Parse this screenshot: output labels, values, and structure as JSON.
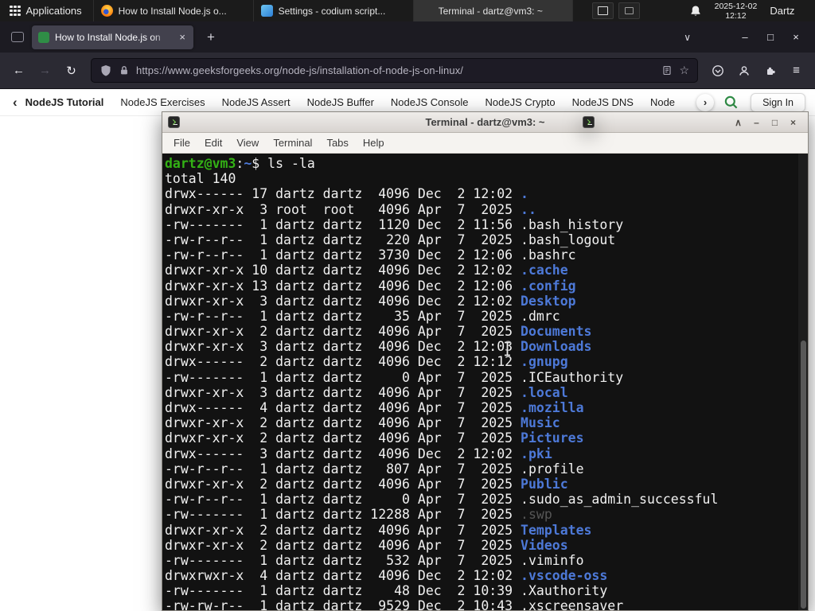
{
  "panel": {
    "applications_label": "Applications",
    "tasks": [
      {
        "label": "How to Install Node.js o...",
        "icon": "firefox",
        "active": false
      },
      {
        "label": "Settings - codium script...",
        "icon": "codium",
        "active": false
      },
      {
        "label": "Terminal - dartz@vm3: ~",
        "icon": "terminal",
        "active": true
      }
    ],
    "clock": {
      "date": "2025-12-02",
      "time": "12:12"
    },
    "user_label": "Dartz"
  },
  "browser": {
    "tab_title": "How to Install Node.js on",
    "url": "https://www.geeksforgeeks.org/node-js/installation-of-node-js-on-linux/"
  },
  "gfg_nav": {
    "items": [
      "NodeJS Tutorial",
      "NodeJS Exercises",
      "NodeJS Assert",
      "NodeJS Buffer",
      "NodeJS Console",
      "NodeJS Crypto",
      "NodeJS DNS",
      "Node"
    ],
    "sign_in_label": "Sign In"
  },
  "terminal": {
    "window_title": "Terminal - dartz@vm3: ~",
    "menu": [
      "File",
      "Edit",
      "View",
      "Terminal",
      "Tabs",
      "Help"
    ],
    "prompt": {
      "user": "dartz@vm3",
      "sep": ":",
      "path": "~",
      "symbol": "$ ",
      "command": "ls -la"
    },
    "total": "total 140",
    "listing": [
      {
        "meta": "drwx------ 17 dartz dartz  4096 Dec  2 12:02 ",
        "name": ".",
        "type": "dir"
      },
      {
        "meta": "drwxr-xr-x  3 root  root   4096 Apr  7  2025 ",
        "name": "..",
        "type": "dir"
      },
      {
        "meta": "-rw-------  1 dartz dartz  1120 Dec  2 11:56 ",
        "name": ".bash_history",
        "type": "file"
      },
      {
        "meta": "-rw-r--r--  1 dartz dartz   220 Apr  7  2025 ",
        "name": ".bash_logout",
        "type": "file"
      },
      {
        "meta": "-rw-r--r--  1 dartz dartz  3730 Dec  2 12:06 ",
        "name": ".bashrc",
        "type": "file"
      },
      {
        "meta": "drwxr-xr-x 10 dartz dartz  4096 Dec  2 12:02 ",
        "name": ".cache",
        "type": "dir"
      },
      {
        "meta": "drwxr-xr-x 13 dartz dartz  4096 Dec  2 12:06 ",
        "name": ".config",
        "type": "dir"
      },
      {
        "meta": "drwxr-xr-x  3 dartz dartz  4096 Dec  2 12:02 ",
        "name": "Desktop",
        "type": "dir"
      },
      {
        "meta": "-rw-r--r--  1 dartz dartz    35 Apr  7  2025 ",
        "name": ".dmrc",
        "type": "file"
      },
      {
        "meta": "drwxr-xr-x  2 dartz dartz  4096 Apr  7  2025 ",
        "name": "Documents",
        "type": "dir"
      },
      {
        "meta": "drwxr-xr-x  3 dartz dartz  4096 Dec  2 12:03 ",
        "name": "Downloads",
        "type": "dir"
      },
      {
        "meta": "drwx------  2 dartz dartz  4096 Dec  2 12:12 ",
        "name": ".gnupg",
        "type": "dir"
      },
      {
        "meta": "-rw-------  1 dartz dartz     0 Apr  7  2025 ",
        "name": ".ICEauthority",
        "type": "file"
      },
      {
        "meta": "drwxr-xr-x  3 dartz dartz  4096 Apr  7  2025 ",
        "name": ".local",
        "type": "dir"
      },
      {
        "meta": "drwx------  4 dartz dartz  4096 Apr  7  2025 ",
        "name": ".mozilla",
        "type": "dir"
      },
      {
        "meta": "drwxr-xr-x  2 dartz dartz  4096 Apr  7  2025 ",
        "name": "Music",
        "type": "dir"
      },
      {
        "meta": "drwxr-xr-x  2 dartz dartz  4096 Apr  7  2025 ",
        "name": "Pictures",
        "type": "dir"
      },
      {
        "meta": "drwx------  3 dartz dartz  4096 Dec  2 12:02 ",
        "name": ".pki",
        "type": "dir"
      },
      {
        "meta": "-rw-r--r--  1 dartz dartz   807 Apr  7  2025 ",
        "name": ".profile",
        "type": "file"
      },
      {
        "meta": "drwxr-xr-x  2 dartz dartz  4096 Apr  7  2025 ",
        "name": "Public",
        "type": "dir"
      },
      {
        "meta": "-rw-r--r--  1 dartz dartz     0 Apr  7  2025 ",
        "name": ".sudo_as_admin_successful",
        "type": "file"
      },
      {
        "meta": "-rw-------  1 dartz dartz 12288 Apr  7  2025 ",
        "name": ".swp",
        "type": "dim"
      },
      {
        "meta": "drwxr-xr-x  2 dartz dartz  4096 Apr  7  2025 ",
        "name": "Templates",
        "type": "dir"
      },
      {
        "meta": "drwxr-xr-x  2 dartz dartz  4096 Apr  7  2025 ",
        "name": "Videos",
        "type": "dir"
      },
      {
        "meta": "-rw-------  1 dartz dartz   532 Apr  7  2025 ",
        "name": ".viminfo",
        "type": "file"
      },
      {
        "meta": "drwxrwxr-x  4 dartz dartz  4096 Dec  2 12:02 ",
        "name": ".vscode-oss",
        "type": "dir"
      },
      {
        "meta": "-rw-------  1 dartz dartz    48 Dec  2 10:39 ",
        "name": ".Xauthority",
        "type": "file"
      },
      {
        "meta": "-rw-rw-r--  1 dartz dartz  9529 Dec  2 10:43 ",
        "name": ".xscreensaver",
        "type": "file"
      }
    ]
  },
  "icons": {
    "back": "←",
    "forward": "→",
    "reload": "↻",
    "star": "☆",
    "menu": "≡",
    "plus": "+",
    "close": "×",
    "minimize": "–",
    "maximize": "□",
    "caret_down": "∨",
    "caret_up": "∧",
    "chevron_left": "‹",
    "chevron_right": "›"
  },
  "colors": {
    "gfg_green": "#2f8d46",
    "terminal_dir_blue": "#4d79d8",
    "terminal_prompt_green": "#33b215"
  }
}
